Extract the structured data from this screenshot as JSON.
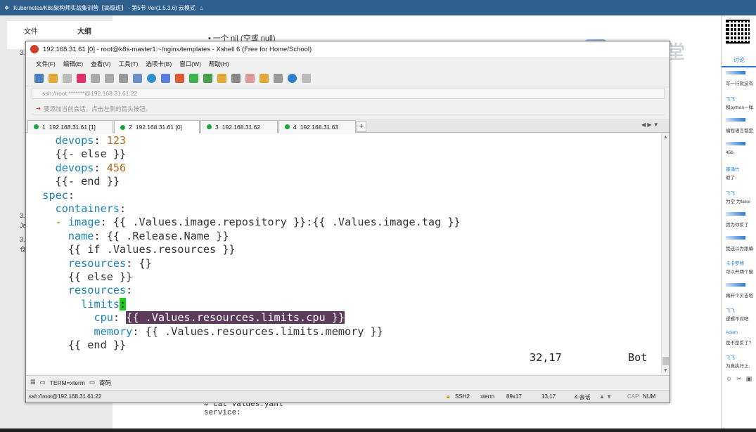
{
  "topbar": {
    "title": "Kubernetes/K8s架构师实战集训营【高级班】 - 第5节 Ver(1.5.3.6) 云模式"
  },
  "background": {
    "tab_file": "文件",
    "tab_outline": "大纲",
    "doc_line1": "• 一个 nil (空或 null)",
    "side_items": [
      "3.",
      "3.",
      "Ja",
      "3.",
      "仓"
    ],
    "code_line1": "# cat values.yaml",
    "code_line2": "service:",
    "watermark": "腾讯课堂"
  },
  "chat": {
    "tab": "讨论",
    "messages": [
      {
        "name": "",
        "text": "写一行就没有"
      },
      {
        "name": "飞飞",
        "text": "和python一样"
      },
      {
        "name": "",
        "text": "编程语言都是"
      },
      {
        "name": "",
        "text": "456"
      },
      {
        "name": "墨涌竹",
        "text": "假了"
      },
      {
        "name": "飞飞",
        "text": "为空 为false"
      },
      {
        "name": "",
        "text": "因为你反了"
      },
      {
        "name": "",
        "text": "我还以为跟编"
      },
      {
        "name": "卡卡罗特",
        "text": "可以开两个窗"
      },
      {
        "name": "",
        "text": "再开个贝吉塔"
      },
      {
        "name": "飞飞",
        "text": "逻辑不对吧"
      },
      {
        "name": "Adam",
        "text": "是不是反了?"
      },
      {
        "name": "飞飞",
        "text": "为真执行上,"
      }
    ]
  },
  "xshell": {
    "title": "192.168.31.61 [0] - root@k8s-master1:~/nginx/templates - Xshell 6 (Free for Home/School)",
    "menu": [
      "文件(F)",
      "编辑(E)",
      "查看(V)",
      "工具(T)",
      "选项卡(B)",
      "窗口(W)",
      "帮助(H)"
    ],
    "address": "ssh://root:*******@192.168.31.61:22",
    "hint": "要添加当前会话，点击左侧的箭头按钮。",
    "tabs": [
      {
        "num": "1",
        "label": "192.168.31.61 [1]"
      },
      {
        "num": "2",
        "label": "192.168.31.61 [0]"
      },
      {
        "num": "3",
        "label": "192.168.31.62"
      },
      {
        "num": "4",
        "label": "192.168.31.63"
      }
    ],
    "tab_add": "+",
    "terminal_lines": [
      [
        {
          "t": "    ",
          "c": ""
        },
        {
          "t": "devops",
          "c": "k"
        },
        {
          "t": ": ",
          "c": ""
        },
        {
          "t": "123",
          "c": "d"
        }
      ],
      [
        {
          "t": "    {{- else }}",
          "c": ""
        }
      ],
      [
        {
          "t": "    ",
          "c": ""
        },
        {
          "t": "devops",
          "c": "k"
        },
        {
          "t": ": ",
          "c": ""
        },
        {
          "t": "456",
          "c": "d"
        }
      ],
      [
        {
          "t": "    {{- end }}",
          "c": ""
        }
      ],
      [
        {
          "t": "  ",
          "c": ""
        },
        {
          "t": "spec",
          "c": "k"
        },
        {
          "t": ":",
          "c": ""
        }
      ],
      [
        {
          "t": "    ",
          "c": ""
        },
        {
          "t": "containers",
          "c": "k"
        },
        {
          "t": ":",
          "c": ""
        }
      ],
      [
        {
          "t": "    ",
          "c": ""
        },
        {
          "t": "-",
          "c": "v"
        },
        {
          "t": " ",
          "c": ""
        },
        {
          "t": "image",
          "c": "k"
        },
        {
          "t": ": {{ .Values.image.repository }}:{{ .Values.image.tag }}",
          "c": ""
        }
      ],
      [
        {
          "t": "      ",
          "c": ""
        },
        {
          "t": "name",
          "c": "k"
        },
        {
          "t": ": {{ .Release.Name }}",
          "c": ""
        }
      ],
      [
        {
          "t": "      {{ if .Values.resources }}",
          "c": ""
        }
      ],
      [
        {
          "t": "      ",
          "c": ""
        },
        {
          "t": "resources",
          "c": "k"
        },
        {
          "t": ": {}",
          "c": ""
        }
      ],
      [
        {
          "t": "      {{ else }}",
          "c": ""
        }
      ],
      [
        {
          "t": "      ",
          "c": ""
        },
        {
          "t": "resources",
          "c": "k"
        },
        {
          "t": ":",
          "c": ""
        }
      ],
      [
        {
          "t": "        ",
          "c": ""
        },
        {
          "t": "limits",
          "c": "k"
        },
        {
          "t": ":",
          "c": "cur"
        }
      ],
      [
        {
          "t": "          ",
          "c": ""
        },
        {
          "t": "cpu",
          "c": "k"
        },
        {
          "t": ": ",
          "c": ""
        },
        {
          "t": "{{ .Values.resources.limits.cpu }}",
          "c": "sel"
        }
      ],
      [
        {
          "t": "          ",
          "c": ""
        },
        {
          "t": "memory",
          "c": "k"
        },
        {
          "t": ": {{ .Values.resources.limits.memory }}",
          "c": ""
        }
      ],
      [
        {
          "t": "      {{ end }}",
          "c": ""
        }
      ]
    ],
    "cursor_pos": "32,17",
    "scroll_pos": "Bot",
    "compose": {
      "term": "TERM=xterm",
      "encoding": "寄码"
    },
    "status": {
      "connection": "ssh://root@192.168.31.61:22",
      "protocol": "SSH2",
      "terminal": "xterm",
      "size": "89x17",
      "cursor": "13,17",
      "sessions": "4 会话",
      "cap": "CAP",
      "num": "NUM"
    }
  }
}
